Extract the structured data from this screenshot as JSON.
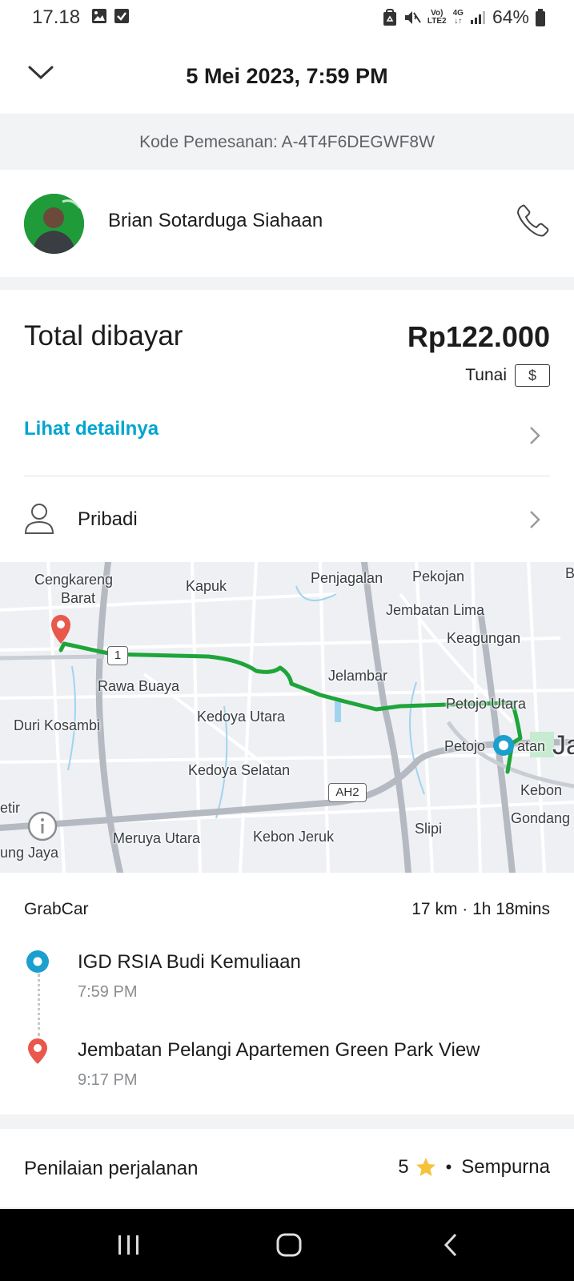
{
  "status_bar": {
    "time": "17.18",
    "network_top": "Vo)",
    "network_bottom": "LTE2",
    "data_top": "4G",
    "data_bottom": "↓↑",
    "battery": "64%"
  },
  "header": {
    "title": "5 Mei 2023, 7:59 PM",
    "back_icon": "chevron-down-icon"
  },
  "booking_code": "Kode Pemesanan: A-4T4F6DEGWF8W",
  "driver": {
    "name": "Brian Sotarduga Siahaan",
    "call_icon": "phone-icon"
  },
  "payment": {
    "total_label": "Total dibayar",
    "total_amount": "Rp122.000",
    "method_label": "Tunai",
    "method_icon_text": "$",
    "details_link": "Lihat detailnya",
    "profile_label": "Pribadi",
    "link_color": "#00a5cf"
  },
  "map": {
    "labels": [
      "Cengkareng",
      "Barat",
      "Kapuk",
      "Penjagalan",
      "Pekojan",
      "B",
      "Jembatan Lima",
      "Keagungan",
      "Jelambar",
      "Rawa Buaya",
      "Kedoya Utara",
      "Duri Kosambi",
      "Petojo Utara",
      "Petojo",
      "atan",
      "Ja",
      "Kedoya Selatan",
      "Kebon",
      "Gondang",
      "etir",
      "Slipi",
      "Meruya Utara",
      "Kebon Jeruk",
      "ung Jaya"
    ],
    "shield_1": "1",
    "shield_ah2": "AH2",
    "route_color": "#1ea53a",
    "origin_color": "#1a9fcf",
    "destination_color": "#e8584c"
  },
  "trip": {
    "service": "GrabCar",
    "summary": "17 km · 1h 18mins",
    "pickup": {
      "name": "IGD RSIA Budi Kemuliaan",
      "time": "7:59 PM"
    },
    "dropoff": {
      "name": "Jembatan Pelangi Apartemen Green Park View",
      "time": "9:17 PM"
    }
  },
  "rating": {
    "label": "Penilaian perjalanan",
    "score": "5",
    "bullet": "•",
    "verdict": "Sempurna",
    "star_color": "#f5c33b"
  }
}
